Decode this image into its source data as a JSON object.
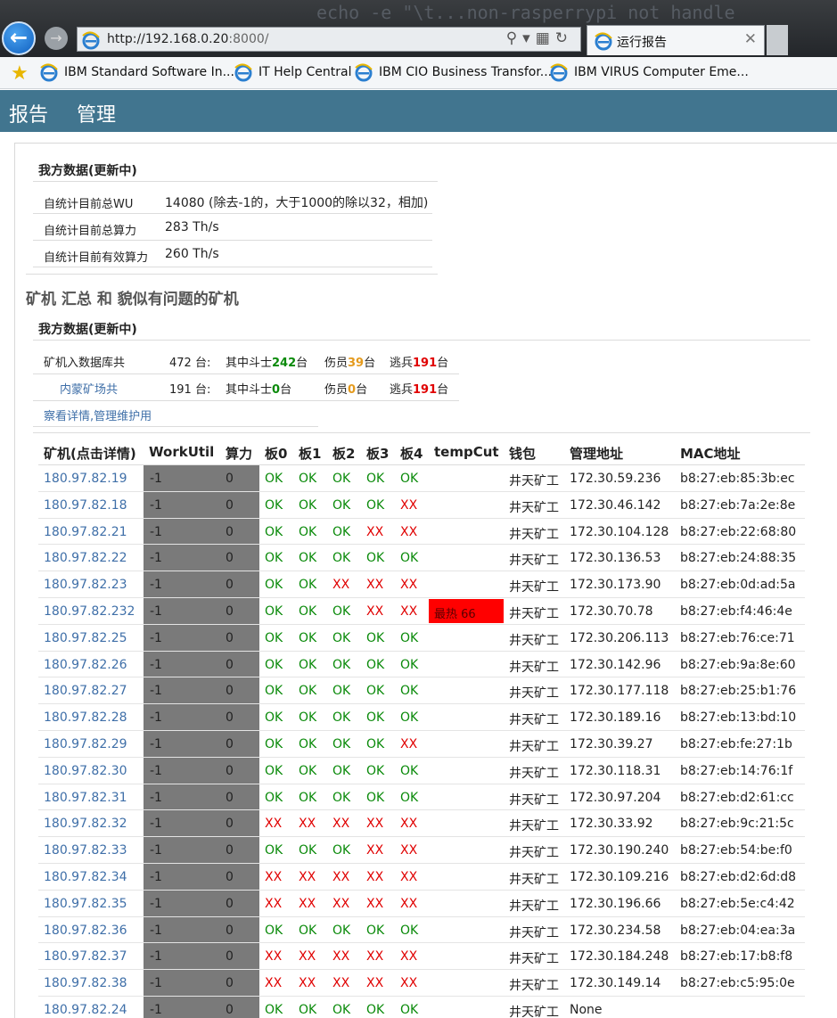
{
  "browser": {
    "terminal_text": "echo -e \"\\t...non-rasperrypi not handle",
    "url_host": "http://192.168.0.20",
    "url_port": ":8000/",
    "tab_title": "运行报告",
    "favorites": [
      {
        "label": "IBM Standard Software In..."
      },
      {
        "label": "IT Help Central"
      },
      {
        "label": "IBM CIO Business Transfor..."
      },
      {
        "label": "IBM VIRUS Computer Eme..."
      }
    ]
  },
  "nav": {
    "report": "报告",
    "manage": "管理"
  },
  "summary": {
    "title": "我方数据(更新中)",
    "rows": [
      {
        "label": "自统计目前总WU",
        "value": "14080 (除去-1的，大于1000的除以32，相加)"
      },
      {
        "label": "自统计目前总算力",
        "value": "283 Th/s"
      },
      {
        "label": "自统计目前有效算力",
        "value": "260 Th/s"
      }
    ]
  },
  "miners_heading": "矿机 汇总 和 貌似有问题的矿机",
  "stats": {
    "title": "我方数据(更新中)",
    "rows": [
      {
        "label": "矿机入数据库共",
        "count": "472 台:",
        "fighters_prefix": "其中斗士",
        "fighters": "242",
        "unit1": "台",
        "wounded_prefix": "伤员",
        "wounded": "39",
        "unit2": "台",
        "deserters_prefix": "逃兵",
        "deserters": "191",
        "unit3": "台"
      },
      {
        "label": "内蒙矿场共",
        "count": "191 台:",
        "fighters_prefix": "其中斗士",
        "fighters": "0",
        "unit1": "台",
        "wounded_prefix": "伤员",
        "wounded": "0",
        "unit2": "台",
        "deserters_prefix": "逃兵",
        "deserters": "191",
        "unit3": "台"
      }
    ],
    "details_link": "察看详情,管理维护用"
  },
  "table": {
    "headers": [
      "矿机(点击详情)",
      "WorkUtil",
      "算力",
      "板0",
      "板1",
      "板2",
      "板3",
      "板4",
      "tempCut",
      "钱包",
      "管理地址",
      "MAC地址"
    ],
    "rows": [
      {
        "ip": "180.97.82.19",
        "wu": "-1",
        "hash": "0",
        "b": [
          "OK",
          "OK",
          "OK",
          "OK",
          "OK"
        ],
        "temp": "",
        "wallet": "井天矿工",
        "mgmt": "172.30.59.236",
        "mac": "b8:27:eb:85:3b:ec"
      },
      {
        "ip": "180.97.82.18",
        "wu": "-1",
        "hash": "0",
        "b": [
          "OK",
          "OK",
          "OK",
          "OK",
          "XX"
        ],
        "temp": "",
        "wallet": "井天矿工",
        "mgmt": "172.30.46.142",
        "mac": "b8:27:eb:7a:2e:8e"
      },
      {
        "ip": "180.97.82.21",
        "wu": "-1",
        "hash": "0",
        "b": [
          "OK",
          "OK",
          "OK",
          "XX",
          "XX"
        ],
        "temp": "",
        "wallet": "井天矿工",
        "mgmt": "172.30.104.128",
        "mac": "b8:27:eb:22:68:80"
      },
      {
        "ip": "180.97.82.22",
        "wu": "-1",
        "hash": "0",
        "b": [
          "OK",
          "OK",
          "OK",
          "OK",
          "OK"
        ],
        "temp": "",
        "wallet": "井天矿工",
        "mgmt": "172.30.136.53",
        "mac": "b8:27:eb:24:88:35"
      },
      {
        "ip": "180.97.82.23",
        "wu": "-1",
        "hash": "0",
        "b": [
          "OK",
          "OK",
          "XX",
          "XX",
          "XX"
        ],
        "temp": "",
        "wallet": "井天矿工",
        "mgmt": "172.30.173.90",
        "mac": "b8:27:eb:0d:ad:5a"
      },
      {
        "ip": "180.97.82.232",
        "wu": "-1",
        "hash": "0",
        "b": [
          "OK",
          "OK",
          "OK",
          "XX",
          "XX"
        ],
        "temp": "最热   66",
        "wallet": "井天矿工",
        "mgmt": "172.30.70.78",
        "mac": "b8:27:eb:f4:46:4e"
      },
      {
        "ip": "180.97.82.25",
        "wu": "-1",
        "hash": "0",
        "b": [
          "OK",
          "OK",
          "OK",
          "OK",
          "OK"
        ],
        "temp": "",
        "wallet": "井天矿工",
        "mgmt": "172.30.206.113",
        "mac": "b8:27:eb:76:ce:71"
      },
      {
        "ip": "180.97.82.26",
        "wu": "-1",
        "hash": "0",
        "b": [
          "OK",
          "OK",
          "OK",
          "OK",
          "OK"
        ],
        "temp": "",
        "wallet": "井天矿工",
        "mgmt": "172.30.142.96",
        "mac": "b8:27:eb:9a:8e:60"
      },
      {
        "ip": "180.97.82.27",
        "wu": "-1",
        "hash": "0",
        "b": [
          "OK",
          "OK",
          "OK",
          "OK",
          "OK"
        ],
        "temp": "",
        "wallet": "井天矿工",
        "mgmt": "172.30.177.118",
        "mac": "b8:27:eb:25:b1:76"
      },
      {
        "ip": "180.97.82.28",
        "wu": "-1",
        "hash": "0",
        "b": [
          "OK",
          "OK",
          "OK",
          "OK",
          "OK"
        ],
        "temp": "",
        "wallet": "井天矿工",
        "mgmt": "172.30.189.16",
        "mac": "b8:27:eb:13:bd:10"
      },
      {
        "ip": "180.97.82.29",
        "wu": "-1",
        "hash": "0",
        "b": [
          "OK",
          "OK",
          "OK",
          "OK",
          "XX"
        ],
        "temp": "",
        "wallet": "井天矿工",
        "mgmt": "172.30.39.27",
        "mac": "b8:27:eb:fe:27:1b"
      },
      {
        "ip": "180.97.82.30",
        "wu": "-1",
        "hash": "0",
        "b": [
          "OK",
          "OK",
          "OK",
          "OK",
          "OK"
        ],
        "temp": "",
        "wallet": "井天矿工",
        "mgmt": "172.30.118.31",
        "mac": "b8:27:eb:14:76:1f"
      },
      {
        "ip": "180.97.82.31",
        "wu": "-1",
        "hash": "0",
        "b": [
          "OK",
          "OK",
          "OK",
          "OK",
          "OK"
        ],
        "temp": "",
        "wallet": "井天矿工",
        "mgmt": "172.30.97.204",
        "mac": "b8:27:eb:d2:61:cc"
      },
      {
        "ip": "180.97.82.32",
        "wu": "-1",
        "hash": "0",
        "b": [
          "XX",
          "XX",
          "XX",
          "XX",
          "XX"
        ],
        "temp": "",
        "wallet": "井天矿工",
        "mgmt": "172.30.33.92",
        "mac": "b8:27:eb:9c:21:5c"
      },
      {
        "ip": "180.97.82.33",
        "wu": "-1",
        "hash": "0",
        "b": [
          "OK",
          "OK",
          "OK",
          "XX",
          "XX"
        ],
        "temp": "",
        "wallet": "井天矿工",
        "mgmt": "172.30.190.240",
        "mac": "b8:27:eb:54:be:f0"
      },
      {
        "ip": "180.97.82.34",
        "wu": "-1",
        "hash": "0",
        "b": [
          "XX",
          "XX",
          "XX",
          "XX",
          "XX"
        ],
        "temp": "",
        "wallet": "井天矿工",
        "mgmt": "172.30.109.216",
        "mac": "b8:27:eb:d2:6d:d8"
      },
      {
        "ip": "180.97.82.35",
        "wu": "-1",
        "hash": "0",
        "b": [
          "XX",
          "XX",
          "XX",
          "XX",
          "XX"
        ],
        "temp": "",
        "wallet": "井天矿工",
        "mgmt": "172.30.196.66",
        "mac": "b8:27:eb:5e:c4:42"
      },
      {
        "ip": "180.97.82.36",
        "wu": "-1",
        "hash": "0",
        "b": [
          "OK",
          "OK",
          "OK",
          "OK",
          "OK"
        ],
        "temp": "",
        "wallet": "井天矿工",
        "mgmt": "172.30.234.58",
        "mac": "b8:27:eb:04:ea:3a"
      },
      {
        "ip": "180.97.82.37",
        "wu": "-1",
        "hash": "0",
        "b": [
          "XX",
          "XX",
          "XX",
          "XX",
          "XX"
        ],
        "temp": "",
        "wallet": "井天矿工",
        "mgmt": "172.30.184.248",
        "mac": "b8:27:eb:17:b8:f8"
      },
      {
        "ip": "180.97.82.38",
        "wu": "-1",
        "hash": "0",
        "b": [
          "XX",
          "XX",
          "XX",
          "XX",
          "XX"
        ],
        "temp": "",
        "wallet": "井天矿工",
        "mgmt": "172.30.149.14",
        "mac": "b8:27:eb:c5:95:0e"
      },
      {
        "ip": "180.97.82.24",
        "wu": "-1",
        "hash": "0",
        "b": [
          "OK",
          "OK",
          "OK",
          "OK",
          "OK"
        ],
        "temp": "",
        "wallet": "井天矿工",
        "mgmt": "None",
        "mac": ""
      }
    ]
  },
  "colors": {
    "nav_bg": "#41758f",
    "ok": "#0a8a0a",
    "fail": "#e00000",
    "wounded": "#e49a1d",
    "hot": "#ff0000",
    "link": "#3f6fa8"
  }
}
